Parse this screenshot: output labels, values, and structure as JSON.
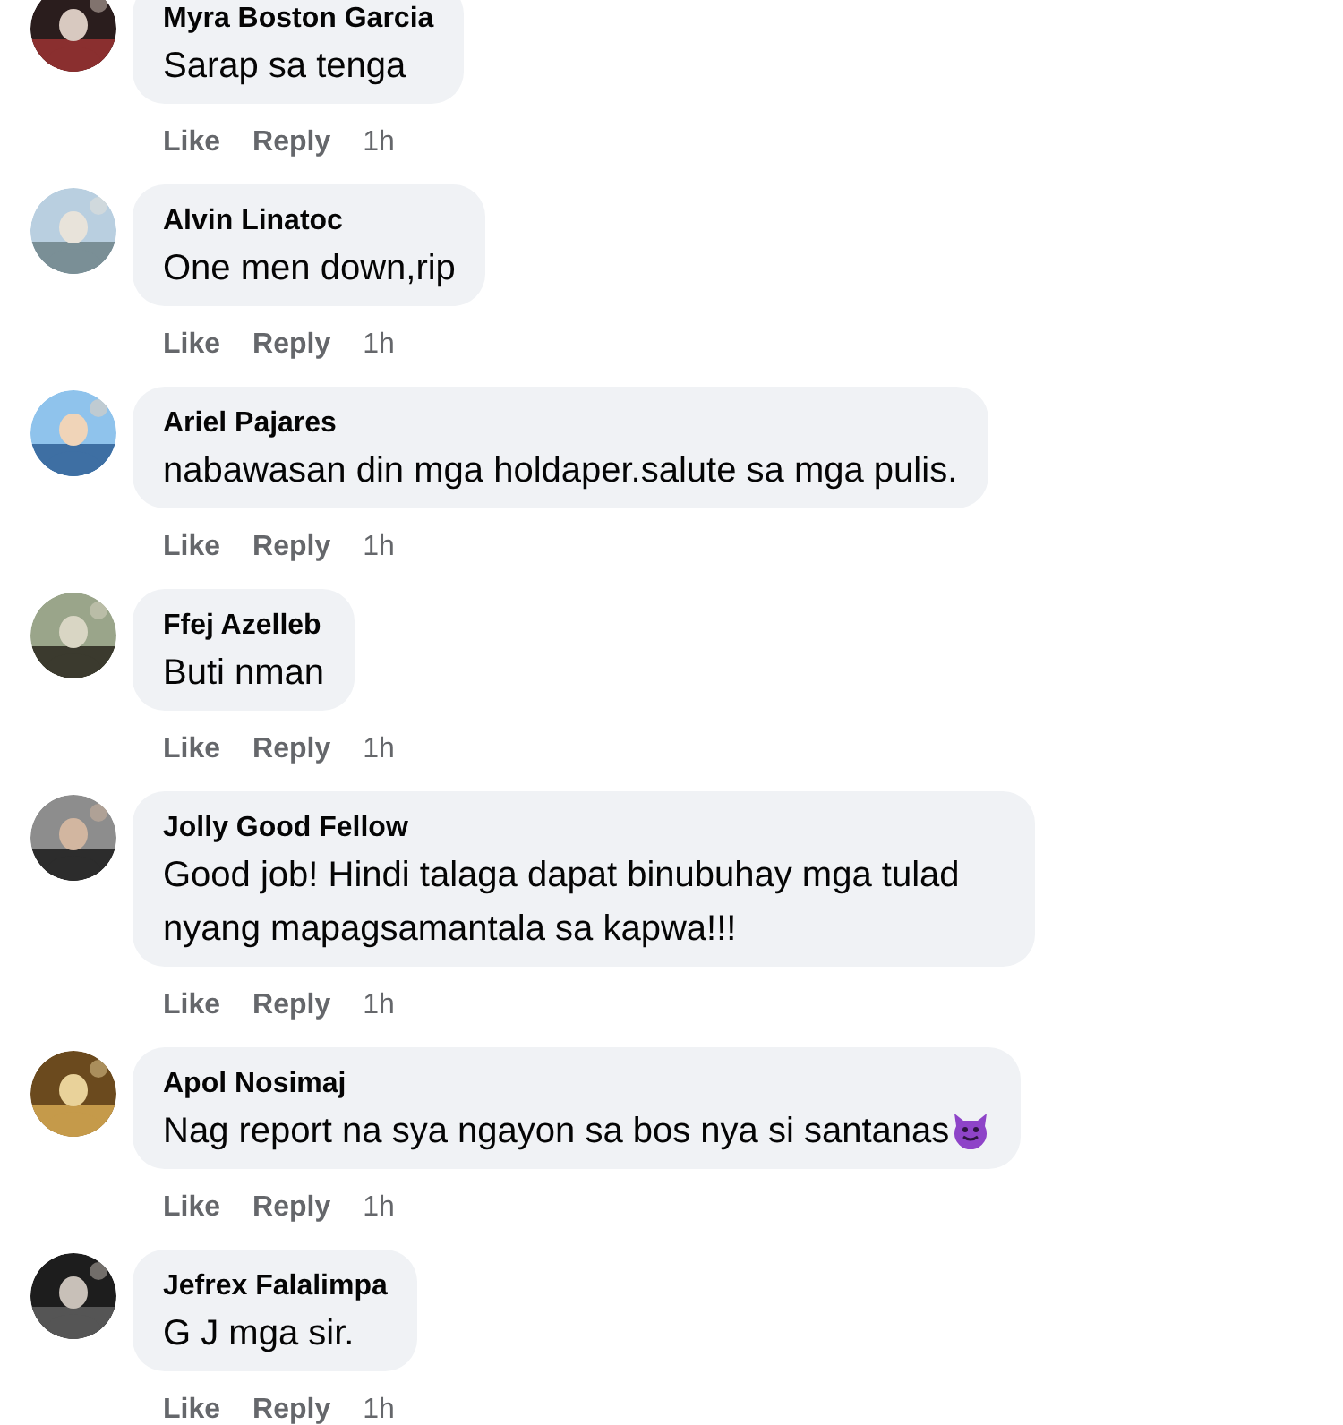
{
  "comments": [
    {
      "author": "Myra Boston Garcia",
      "text": "Sarap sa tenga",
      "actions": [
        "Like",
        "Reply"
      ],
      "time": "1h"
    },
    {
      "author": "Alvin Linatoc",
      "text": "One men down,rip",
      "actions": [
        "Like",
        "Reply"
      ],
      "time": "1h"
    },
    {
      "author": "Ariel Pajares",
      "text": "nabawasan din mga holdaper.salute sa mga pulis.",
      "actions": [
        "Like",
        "Reply"
      ],
      "time": "1h"
    },
    {
      "author": "Ffej Azelleb",
      "text": "Buti nman",
      "actions": [
        "Like",
        "Reply"
      ],
      "time": "1h"
    },
    {
      "author": "Jolly Good Fellow",
      "text": "Good job! Hindi talaga dapat binubuhay mga tulad nyang mapagsamantala sa kapwa!!!",
      "actions": [
        "Like",
        "Reply"
      ],
      "time": "1h"
    },
    {
      "author": "Apol Nosimaj",
      "text": "Nag report na sya ngayon sa bos nya si santanas",
      "trailing_icon": {
        "kind": "devil"
      },
      "actions": [
        "Like",
        "Reply"
      ],
      "time": "1h"
    },
    {
      "author": "Jefrex Falalimpa",
      "text": "G J mga sir.",
      "actions": [
        "Like",
        "Reply"
      ],
      "time": "1h"
    }
  ]
}
